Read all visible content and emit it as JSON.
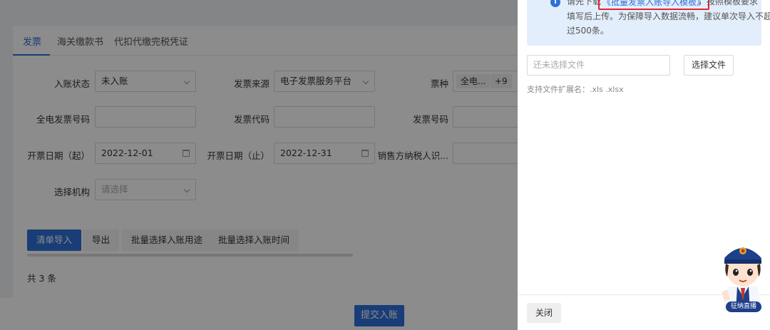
{
  "tabs": [
    "发票",
    "海关缴款书",
    "代扣代缴完税凭证"
  ],
  "filters": {
    "entry_status": {
      "label": "入账状态",
      "value": "未入账"
    },
    "invoice_source": {
      "label": "发票来源",
      "value": "电子发票服务平台"
    },
    "ticket_type": {
      "label": "票种",
      "tag1": "全电...",
      "tag2": "+9"
    },
    "quandian_no": {
      "label": "全电发票号码",
      "value": ""
    },
    "invoice_code": {
      "label": "发票代码",
      "value": ""
    },
    "invoice_no": {
      "label": "发票号码",
      "value": ""
    },
    "date_start": {
      "label": "开票日期（起）",
      "value": "2022-12-01"
    },
    "date_end": {
      "label": "开票日期（止）",
      "value": "2022-12-31"
    },
    "seller_tax_id": {
      "label": "销售方纳税人识...",
      "value": ""
    },
    "org": {
      "label": "选择机构",
      "placeholder": "请选择"
    }
  },
  "actions": {
    "list_import": "清单导入",
    "export": "导出",
    "batch_purpose": "批量选择入账用途",
    "batch_time": "批量选择入账时间"
  },
  "total_text": "共 3 条",
  "submit_label": "提交入账",
  "drawer": {
    "notice_prefix": "请先下载",
    "template_link": "《批量发票入账导入模板》",
    "notice_suffix": "，按照模板要求",
    "notice_line2": "填写后上传。为保障导入数据流畅，建议单次导入不超",
    "notice_line3": "过500条。",
    "file_placeholder": "还未选择文件",
    "choose_file": "选择文件",
    "ext_hint": "支持文件扩展名：.xls .xlsx",
    "close": "关闭"
  },
  "mascot_label": "征纳直播",
  "colors": {
    "primary": "#2f6fd8",
    "highlight": "#e0262b",
    "notice_bg": "#e3eefc"
  }
}
